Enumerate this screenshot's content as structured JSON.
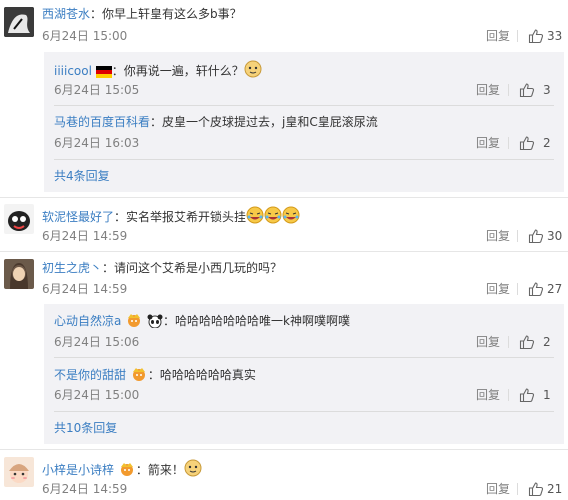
{
  "comments": [
    {
      "user": "西湖苍水",
      "text": "：你早上轩皇有这么多b事？",
      "time": "6月24日 15:00",
      "reply": "回复",
      "likes": "33",
      "replies": [
        {
          "user": "iiiicool",
          "text": "：你再说一遍，轩什么？",
          "time": "6月24日 15:05",
          "reply": "回复",
          "likes": "3"
        },
        {
          "user": "马巷的百度百科看",
          "text": "：皮皇一个皮球提过去，j皇和C皇屁滚尿流",
          "time": "6月24日 16:03",
          "reply": "回复",
          "likes": "2"
        }
      ],
      "more": "共4条回复"
    },
    {
      "user": "软泥怪最好了",
      "text": "：实名举报艾希开锁头挂",
      "time": "6月24日 14:59",
      "reply": "回复",
      "likes": "30"
    },
    {
      "user": "初生之虎丶",
      "text": "：请问这个艾希是小西几玩的吗？",
      "time": "6月24日 14:59",
      "reply": "回复",
      "likes": "27",
      "replies": [
        {
          "user": "心动自然凉a",
          "text": "：哈哈哈哈哈哈哈唯一k神啊噗啊噗",
          "time": "6月24日 15:06",
          "reply": "回复",
          "likes": "2"
        },
        {
          "user": "不是你的甜甜",
          "text": "：哈哈哈哈哈哈真实",
          "time": "6月24日 15:00",
          "reply": "回复",
          "likes": "1"
        }
      ],
      "more": "共10条回复"
    },
    {
      "user": "小梓是小诗梓",
      "text": "：箭来！",
      "time": "6月24日 14:59",
      "reply": "回复",
      "likes": "21"
    }
  ]
}
